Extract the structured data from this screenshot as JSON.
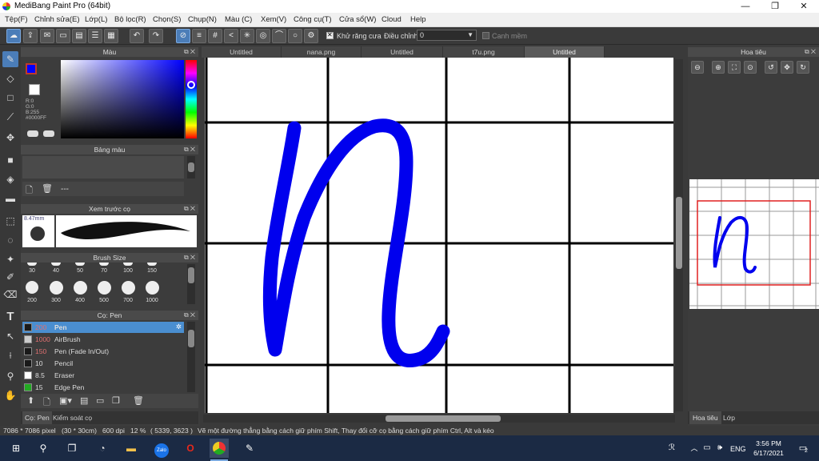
{
  "window": {
    "title": "MediBang Paint Pro (64bit)",
    "minimize": "—",
    "maximize": "❐",
    "close": "✕"
  },
  "menu": [
    "Tệp(F)",
    "Chỉnh sửa(E)",
    "Lớp(L)",
    "Bộ lọc(R)",
    "Chọn(S)",
    "Chụp(N)",
    "Màu (C)",
    "Xem(V)",
    "Công cụ(T)",
    "Cửa sổ(W)",
    "Cloud",
    "Help"
  ],
  "toolbar": {
    "antialias_label": "Khử răng cưa",
    "adjust_label": "Điều chỉnh",
    "adjust_value": "0",
    "snap_label": "Canh mềm"
  },
  "color_panel": {
    "title": "Màu",
    "r": "R:0",
    "g": "G:0",
    "b": "B:255",
    "hex": "#0000FF",
    "fg": "#0000ff",
    "bg": "#ffffff"
  },
  "palette_panel": {
    "title": "Bảng màu",
    "dash": "---"
  },
  "brush_preview": {
    "title": "Xem trước cọ",
    "size": "8.47mm"
  },
  "brush_size_panel": {
    "title": "Brush Size",
    "row1": [
      "30",
      "40",
      "50",
      "70",
      "100",
      "150"
    ],
    "row2": [
      "200",
      "300",
      "400",
      "500",
      "700",
      "1000"
    ]
  },
  "brush_panel": {
    "title": "Cọ: Pen",
    "items": [
      {
        "size": "200",
        "name": "Pen",
        "color": "#1a1a1a",
        "selected": true
      },
      {
        "size": "1000",
        "name": "AirBrush",
        "color": "#cccccc"
      },
      {
        "size": "150",
        "name": "Pen (Fade In/Out)",
        "color": "#1a1a1a"
      },
      {
        "size": "10",
        "name": "Pencil",
        "color": "#1a1a1a"
      },
      {
        "size": "8.5",
        "name": "Eraser",
        "color": "#ffffff"
      },
      {
        "size": "15",
        "name": "Edge Pen",
        "color": "#22aa22"
      }
    ]
  },
  "bottom_tabs": {
    "brush": "Cọ: Pen",
    "control": "Kiểm soát cọ"
  },
  "tabs": [
    "Untitled",
    "nana.png",
    "Untitled",
    "t7u.png",
    "Untitled"
  ],
  "navigator": {
    "title": "Hoa tiêu",
    "tab_nav": "Hoa tiêu",
    "tab_layer": "Lớp"
  },
  "status": {
    "dimensions": "7086 * 7086 pixel",
    "size_cm": "(30 * 30cm)",
    "dpi": "600 dpi",
    "zoom": "12 %",
    "coords": "( 5339, 3623 )",
    "hint": "Vẽ một đường thẳng bằng cách giữ phím Shift, Thay đổi cỡ cọ bằng cách giữ phím Ctrl, Alt và kéo"
  },
  "taskbar": {
    "lang": "ENG",
    "time": "3:56 PM",
    "date": "6/17/2021",
    "notif": "2"
  },
  "stroke_color": "#0000ee",
  "accent": "#4b7db8"
}
